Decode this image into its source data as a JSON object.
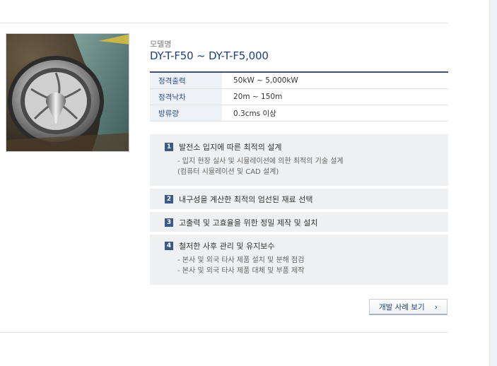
{
  "model": {
    "label": "모델명",
    "name": "DY-T-F50 ~ DY-T-F5,000"
  },
  "specs": [
    {
      "key": "정격출력",
      "value": "50kW ~ 5,000kW"
    },
    {
      "key": "정격낙차",
      "value": "20m ~ 150m"
    },
    {
      "key": "방류량",
      "value": "0.3cms 이상"
    }
  ],
  "features": [
    {
      "num": "1",
      "title": "발전소 입지에 따른 최적의 설계",
      "lines": [
        "- 입지 현장 실사 및 시뮬레이션에 의한 최적의 기술 설계",
        "(컴퓨터 시뮬레이션 및 CAD 설계)"
      ]
    },
    {
      "num": "2",
      "title": "내구성을 계산한 최적의 엄선된 재료 선택"
    },
    {
      "num": "3",
      "title": "고출력 및 고효율을 위한 정밀 제작 및 설치"
    },
    {
      "num": "4",
      "title": "철저한 사후 관리 및 유지보수",
      "lines": [
        "- 본사 및 외국 타사 제품 설치 및 분해 점검",
        "- 본사 및 외국 타사 제품 대체 및 부품 제작"
      ]
    }
  ],
  "button": {
    "label": "개발 사례 보기",
    "chevron": "›"
  },
  "icons": {
    "chevron": "chevron-right-icon"
  },
  "colors": {
    "accent": "#1d3f7a",
    "badge": "#3b5a8a",
    "table_rule": "#3e4f76"
  }
}
